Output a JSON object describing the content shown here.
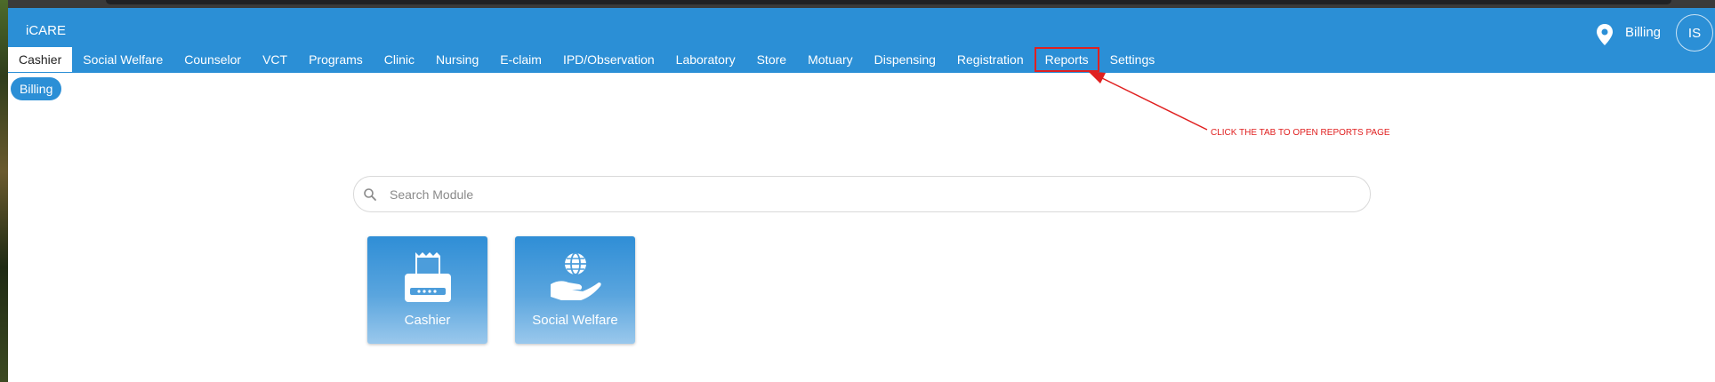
{
  "app": {
    "brand": "iCARE"
  },
  "header": {
    "location_label": "Billing",
    "avatar_initials": "IS"
  },
  "tabs": [
    {
      "label": "Cashier",
      "active": true
    },
    {
      "label": "Social Welfare"
    },
    {
      "label": "Counselor"
    },
    {
      "label": "VCT"
    },
    {
      "label": "Programs"
    },
    {
      "label": "Clinic"
    },
    {
      "label": "Nursing"
    },
    {
      "label": "E-claim"
    },
    {
      "label": "IPD/Observation"
    },
    {
      "label": "Laboratory"
    },
    {
      "label": "Store"
    },
    {
      "label": "Motuary"
    },
    {
      "label": "Dispensing"
    },
    {
      "label": "Registration"
    },
    {
      "label": "Reports",
      "highlighted": true
    },
    {
      "label": "Settings"
    }
  ],
  "subtabs": [
    {
      "label": "Billing"
    }
  ],
  "annotation": {
    "text": "CLICK THE TAB TO OPEN REPORTS PAGE",
    "color": "#e02020"
  },
  "search": {
    "placeholder": "Search Module",
    "value": "",
    "icon": "search-icon"
  },
  "modules": [
    {
      "label": "Cashier",
      "icon": "receipt-printer-icon"
    },
    {
      "label": "Social Welfare",
      "icon": "hand-globe-icon"
    }
  ],
  "colors": {
    "primary": "#2b8fd6",
    "annotation": "#e02020"
  }
}
